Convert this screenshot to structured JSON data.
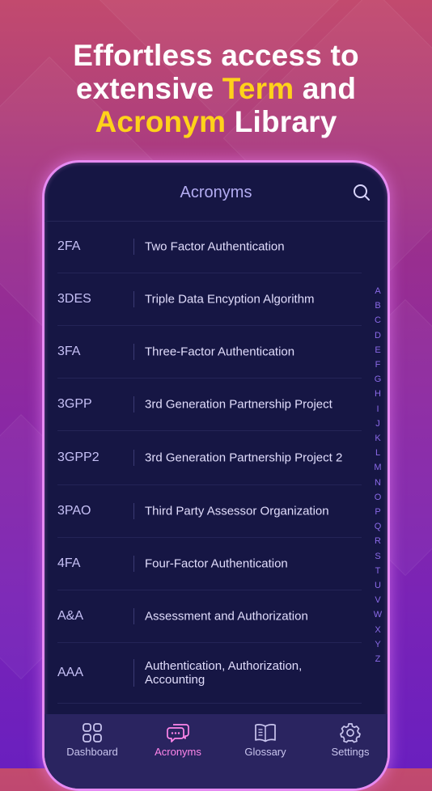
{
  "headline": {
    "line1": "Effortless access to",
    "line2_pre": "extensive ",
    "line2_highlight": "Term",
    "line2_post": " and",
    "line3_highlight": "Acronym",
    "line3_post": " Library",
    "highlight_color": "#ffd21a"
  },
  "header": {
    "title": "Acronyms",
    "search_icon": "search-icon"
  },
  "acronyms": [
    {
      "abbr": "2FA",
      "definition": "Two Factor Authentication"
    },
    {
      "abbr": "3DES",
      "definition": "Triple Data Encyption Algorithm"
    },
    {
      "abbr": "3FA",
      "definition": "Three-Factor Authentication"
    },
    {
      "abbr": "3GPP",
      "definition": "3rd Generation Partnership Project"
    },
    {
      "abbr": "3GPP2",
      "definition": "3rd Generation Partnership Project 2"
    },
    {
      "abbr": "3PAO",
      "definition": "Third Party Assessor Organization"
    },
    {
      "abbr": "4FA",
      "definition": "Four-Factor Authentication"
    },
    {
      "abbr": "A&A",
      "definition": "Assessment and Authorization"
    },
    {
      "abbr": "AAA",
      "definition": "Authentication, Authorization, Accounting"
    }
  ],
  "alphabet_index": [
    "A",
    "B",
    "C",
    "D",
    "E",
    "F",
    "G",
    "H",
    "I",
    "J",
    "K",
    "L",
    "M",
    "N",
    "O",
    "P",
    "Q",
    "R",
    "S",
    "T",
    "U",
    "V",
    "W",
    "X",
    "Y",
    "Z"
  ],
  "tabs": [
    {
      "label": "Dashboard",
      "icon": "grid-icon",
      "active": false
    },
    {
      "label": "Acronyms",
      "icon": "chat-bubbles-icon",
      "active": true
    },
    {
      "label": "Glossary",
      "icon": "book-icon",
      "active": false
    },
    {
      "label": "Settings",
      "icon": "gear-icon",
      "active": false
    }
  ],
  "colors": {
    "accent_active": "#ff86ea",
    "panel": "#161644",
    "tabbar": "#2a2460",
    "index_letters": "#8b6ae8"
  }
}
